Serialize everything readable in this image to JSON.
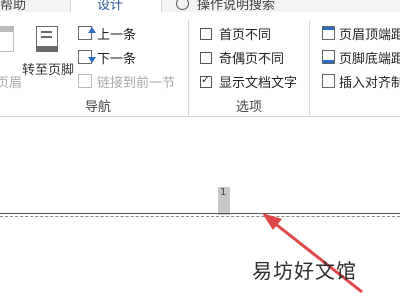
{
  "tabs": {
    "help": "帮助",
    "design": "设计",
    "tell_me": "操作说明搜索"
  },
  "navigation": {
    "header_label": "页眉",
    "goto_footer": "转至页脚",
    "previous": "上一条",
    "next": "下一条",
    "link_to_previous": "链接到前一节",
    "group_label": "导航"
  },
  "options": {
    "different_first_page": "首页不同",
    "different_odd_even": "奇偶页不同",
    "show_document_text": "显示文档文字",
    "checked": {
      "different_first_page": false,
      "different_odd_even": false,
      "show_document_text": true
    },
    "group_label": "选项"
  },
  "position": {
    "header_from_top": "页眉顶端距",
    "footer_from_bottom": "页脚底端距",
    "insert_alignment_tab": "插入对齐制"
  },
  "document": {
    "page_number": "1"
  },
  "watermark": "易坊好文馆",
  "colors": {
    "accent": "#2b579a",
    "arrow": "#e04646"
  }
}
